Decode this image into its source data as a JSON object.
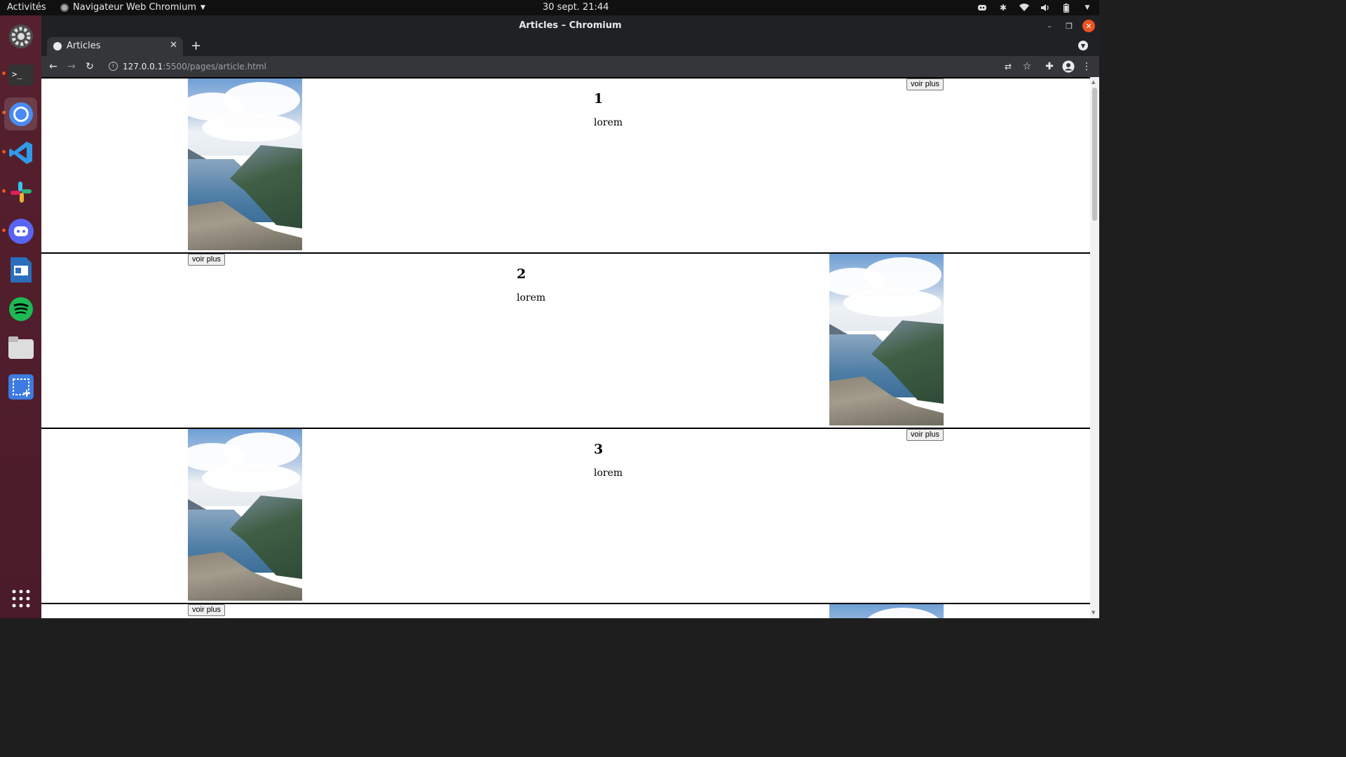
{
  "topbar": {
    "activities": "Activités",
    "app_menu": "Navigateur Web Chromium",
    "clock": "30 sept.  21:44"
  },
  "dock": {
    "items": [
      {
        "name": "settings-icon"
      },
      {
        "name": "terminal-icon"
      },
      {
        "name": "chromium-icon"
      },
      {
        "name": "vscode-icon"
      },
      {
        "name": "slack-icon"
      },
      {
        "name": "discord-icon"
      },
      {
        "name": "writer-icon"
      },
      {
        "name": "spotify-icon"
      },
      {
        "name": "files-icon"
      },
      {
        "name": "screenshot-icon"
      },
      {
        "name": "app-grid-icon"
      }
    ]
  },
  "window": {
    "title": "Articles – Chromium"
  },
  "tabs": [
    {
      "label": "Articles"
    }
  ],
  "toolbar": {
    "url_host": "127.0.0.1",
    "url_path": ":5500/pages/article.html"
  },
  "articles": [
    {
      "number": "1",
      "text": "lorem",
      "button": "voir plus"
    },
    {
      "number": "2",
      "text": "lorem",
      "button": "voir plus"
    },
    {
      "number": "3",
      "text": "lorem",
      "button": "voir plus"
    },
    {
      "button": "voir plus"
    }
  ],
  "colors": {
    "ubuntu_orange": "#e95420",
    "chrome_dark": "#202124",
    "toolbar_dark": "#35363a"
  }
}
